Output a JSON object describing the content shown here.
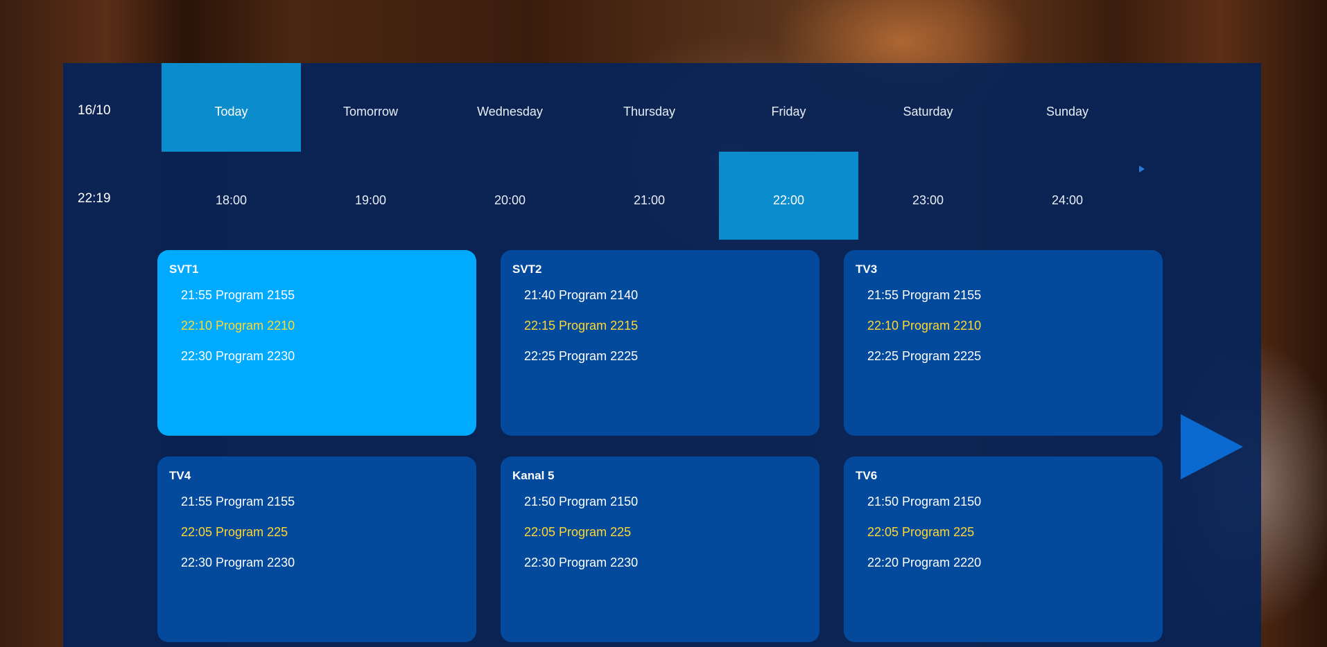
{
  "header": {
    "date": "16/10",
    "clock": "22:19"
  },
  "days": [
    {
      "label": "Today",
      "active": true
    },
    {
      "label": "Tomorrow",
      "active": false
    },
    {
      "label": "Wednesday",
      "active": false
    },
    {
      "label": "Thursday",
      "active": false
    },
    {
      "label": "Friday",
      "active": false
    },
    {
      "label": "Saturday",
      "active": false
    },
    {
      "label": "Sunday",
      "active": false
    }
  ],
  "hours": [
    {
      "label": "18:00",
      "active": false
    },
    {
      "label": "19:00",
      "active": false
    },
    {
      "label": "20:00",
      "active": false
    },
    {
      "label": "21:00",
      "active": false
    },
    {
      "label": "22:00",
      "active": true
    },
    {
      "label": "23:00",
      "active": false
    },
    {
      "label": "24:00",
      "active": false
    }
  ],
  "channels": [
    {
      "name": "SVT1",
      "selected": true,
      "programs": [
        "21:55 Program 2155",
        "22:10 Program 2210",
        "22:30 Program 2230"
      ]
    },
    {
      "name": "SVT2",
      "selected": false,
      "programs": [
        "21:40 Program 2140",
        "22:15 Program 2215",
        "22:25 Program 2225"
      ]
    },
    {
      "name": "TV3",
      "selected": false,
      "programs": [
        "21:55 Program 2155",
        "22:10 Program 2210",
        "22:25 Program 2225"
      ]
    },
    {
      "name": "TV4",
      "selected": false,
      "programs": [
        "21:55 Program 2155",
        "22:05 Program 225",
        "22:30 Program 2230"
      ]
    },
    {
      "name": "Kanal 5",
      "selected": false,
      "programs": [
        "21:50 Program 2150",
        "22:05 Program 225",
        "22:30 Program 2230"
      ]
    },
    {
      "name": "TV6",
      "selected": false,
      "programs": [
        "21:50 Program 2150",
        "22:05 Program 225",
        "22:20 Program 2220"
      ]
    }
  ],
  "colors": {
    "panel": "#062458",
    "active_tab": "#0b8ccc",
    "card": "#044a9c",
    "card_selected": "#00abff",
    "current_program": "#ffd832",
    "arrow": "#0a6ad0"
  },
  "icons": {
    "hours_scroll": "play-triangle-icon",
    "next_page": "play-triangle-icon"
  }
}
